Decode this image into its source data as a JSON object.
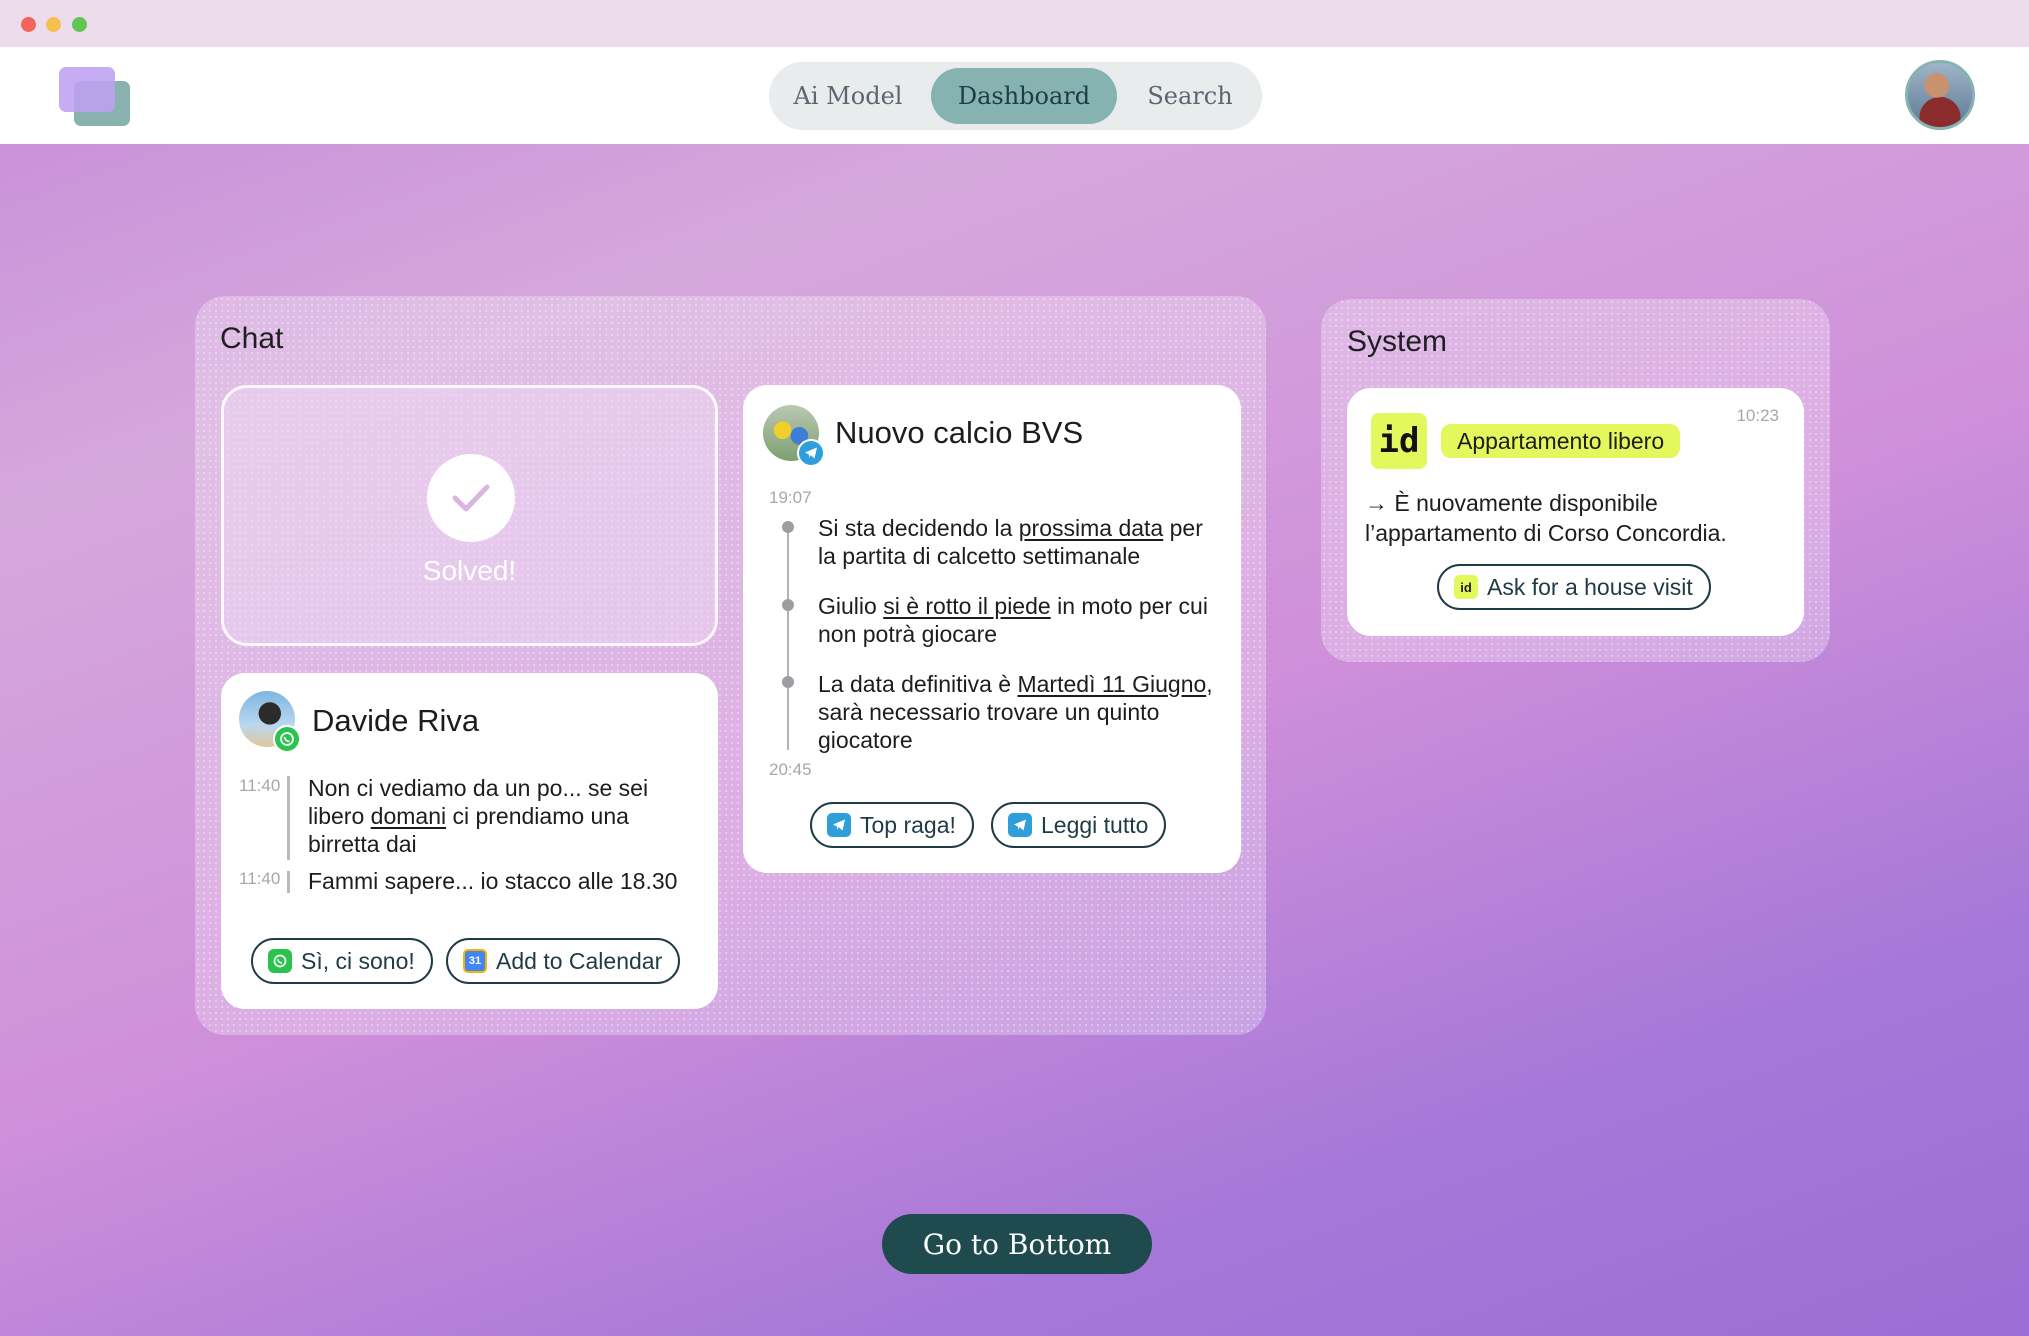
{
  "nav": {
    "tabs": [
      {
        "label": "Ai Model"
      },
      {
        "label": "Dashboard",
        "active": true
      },
      {
        "label": "Search"
      }
    ]
  },
  "chat_panel": {
    "title": "Chat",
    "solved": {
      "label": "Solved!",
      "icon": "check-icon"
    },
    "davide": {
      "name": "Davide Riva",
      "channel_icon": "whatsapp-icon",
      "messages": [
        {
          "time": "11:40",
          "text_before": "Non ci vediamo da un po... se sei libero ",
          "link": "domani",
          "text_after": " ci prendiamo una birretta dai"
        },
        {
          "time": "11:40",
          "text": "Fammi sapere... io stacco alle 18.30"
        }
      ],
      "actions": [
        {
          "label": "Sì, ci sono!",
          "icon": "whatsapp-icon"
        },
        {
          "label": "Add to Calendar",
          "icon": "calendar-icon",
          "icon_text": "31"
        }
      ]
    },
    "calcio": {
      "name": "Nuovo calcio BVS",
      "channel_icon": "telegram-icon",
      "time_start": "19:07",
      "time_end": "20:45",
      "messages": [
        {
          "before": "Si sta decidendo la ",
          "link": "prossima data",
          "after": " per la partita di calcetto settimanale"
        },
        {
          "before": "Giulio ",
          "link": "si è rotto il piede",
          "after": " in moto per cui non potrà giocare"
        },
        {
          "before": "La data definitiva è ",
          "link": "Martedì 11 Giugno",
          "after": ", sarà necessario trovare un quinto giocatore"
        }
      ],
      "actions": [
        {
          "label": "Top raga!",
          "icon": "telegram-icon"
        },
        {
          "label": "Leggi tutto",
          "icon": "telegram-icon"
        }
      ]
    }
  },
  "system_panel": {
    "title": "System",
    "card": {
      "logo_text": "id",
      "tag": "Appartamento libero",
      "time": "10:23",
      "body": "→ È nuovamente disponibile l’appartamento di Corso Concordia.",
      "action": {
        "label": "Ask for a house visit",
        "icon": "id-icon",
        "icon_text": "id"
      }
    }
  },
  "footer": {
    "goto_label": "Go to Bottom"
  },
  "colors": {
    "accent_teal": "#86b3b2",
    "dark_teal": "#1f4a4e",
    "lime": "#e2f85c",
    "whatsapp": "#29c44e",
    "telegram": "#2e9fdb"
  }
}
